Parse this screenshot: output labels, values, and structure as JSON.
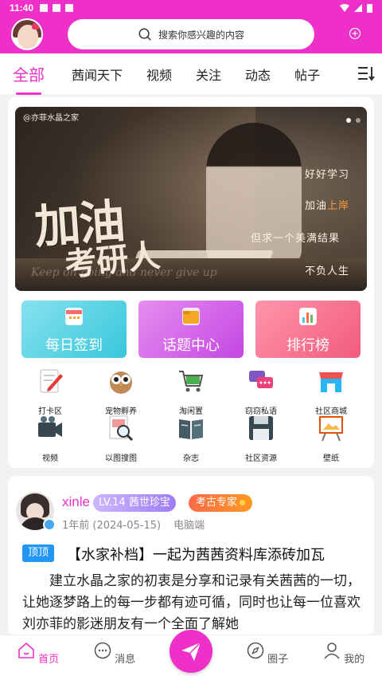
{
  "status_bar": {
    "time": "11:40"
  },
  "search": {
    "placeholder": "搜索你感兴趣的内容"
  },
  "tabs": [
    {
      "label": "全部",
      "active": true
    },
    {
      "label": "茜闻天下"
    },
    {
      "label": "视频"
    },
    {
      "label": "关注"
    },
    {
      "label": "动态"
    },
    {
      "label": "帖子"
    }
  ],
  "banner": {
    "watermark": "@亦菲水晶之家",
    "headline": "加油",
    "subline": "考研人",
    "quotes": [
      "好好学习",
      "加油",
      "上岸",
      "但求一个美满结果",
      "不负人生"
    ],
    "script": "Keep on going and never give up",
    "page": 1,
    "pages": 2
  },
  "features": [
    {
      "label": "每日签到"
    },
    {
      "label": "话题中心"
    },
    {
      "label": "排行榜"
    }
  ],
  "grid": [
    {
      "label": "打卡区",
      "icon": "checkin-icon"
    },
    {
      "label": "宠物孵养",
      "icon": "owl-icon"
    },
    {
      "label": "淘闲置",
      "icon": "cart-icon"
    },
    {
      "label": "窃窃私语",
      "icon": "chat-icon"
    },
    {
      "label": "社区商城",
      "icon": "shop-icon"
    },
    {
      "label": "视频",
      "icon": "camera-icon"
    },
    {
      "label": "以图搜图",
      "icon": "image-search-icon"
    },
    {
      "label": "杂志",
      "icon": "magazine-icon"
    },
    {
      "label": "社区资源",
      "icon": "floppy-icon"
    },
    {
      "label": "壁纸",
      "icon": "easel-icon"
    }
  ],
  "post": {
    "username": "xinle",
    "level": "LV.14 茜世珍宝",
    "badge": "考古专家",
    "time": "1年前 (2024-05-15)",
    "device": "电脑端",
    "pin": "顶顶",
    "title": "【水家补档】一起为茜茜资料库添砖加瓦",
    "body": "建立水晶之家的初衷是分享和记录有关茜茜的一切，让她逐梦路上的每一步都有迹可循，同时也让每一位喜欢刘亦菲的影迷朋友有一个全面了解她"
  },
  "bottom_nav": [
    {
      "label": "首页",
      "active": true
    },
    {
      "label": "消息"
    },
    {
      "label": "圈子"
    },
    {
      "label": "我的"
    }
  ],
  "colors": {
    "brand": "#ee2fc8",
    "pin": "#2196f3"
  }
}
